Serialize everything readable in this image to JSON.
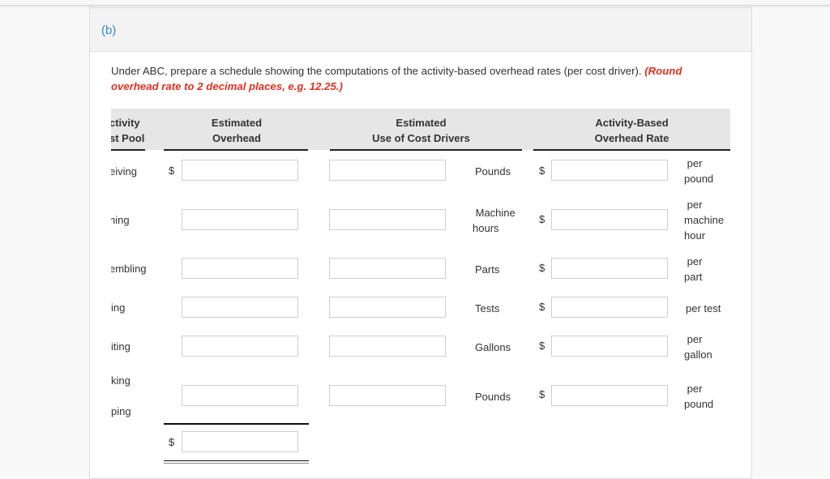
{
  "part": "(b)",
  "instructions": {
    "text": "Under ABC, prepare a schedule showing the computations of the activity-based overhead rates (per cost driver). ",
    "note_line1": "(Round",
    "note_line2": "overhead rate to 2 decimal places, e.g. 12.25.)"
  },
  "table": {
    "headers": {
      "activity_line1": "ctivity",
      "activity_line2": "st Pool",
      "overhead_line1": "Estimated",
      "overhead_line2": "Overhead",
      "drivers_line1": "Estimated",
      "drivers_line2": "Use of Cost Drivers",
      "rate_line1": "Activity-Based",
      "rate_line2": "Overhead Rate"
    },
    "currency_symbol": "$",
    "rows": [
      {
        "activity": "eiving",
        "overhead": "",
        "driver_use": "",
        "driver_unit": "Pounds",
        "rate": "",
        "rate_unit_line1": "per",
        "rate_unit_line2": "pound"
      },
      {
        "activity": "ning",
        "overhead": "",
        "driver_use": "",
        "driver_unit_line1": "Machine",
        "driver_unit_line2": "hours",
        "rate": "",
        "rate_unit_line1": "per",
        "rate_unit_line2": "machine",
        "rate_unit_line3": "hour"
      },
      {
        "activity": "embling",
        "overhead": "",
        "driver_use": "",
        "driver_unit": "Parts",
        "rate": "",
        "rate_unit_line1": "per",
        "rate_unit_line2": "part"
      },
      {
        "activity": "ing",
        "overhead": "",
        "driver_use": "",
        "driver_unit": "Tests",
        "rate": "",
        "rate_unit": "per test"
      },
      {
        "activity": "iting",
        "overhead": "",
        "driver_use": "",
        "driver_unit": "Gallons",
        "rate": "",
        "rate_unit_line1": "per",
        "rate_unit_line2": "gallon"
      },
      {
        "activity_line1": "king",
        "activity_line2": "ping",
        "overhead": "",
        "driver_use": "",
        "driver_unit": "Pounds",
        "rate": "",
        "rate_unit_line1": "per",
        "rate_unit_line2": "pound"
      }
    ],
    "total": {
      "overhead": ""
    }
  }
}
